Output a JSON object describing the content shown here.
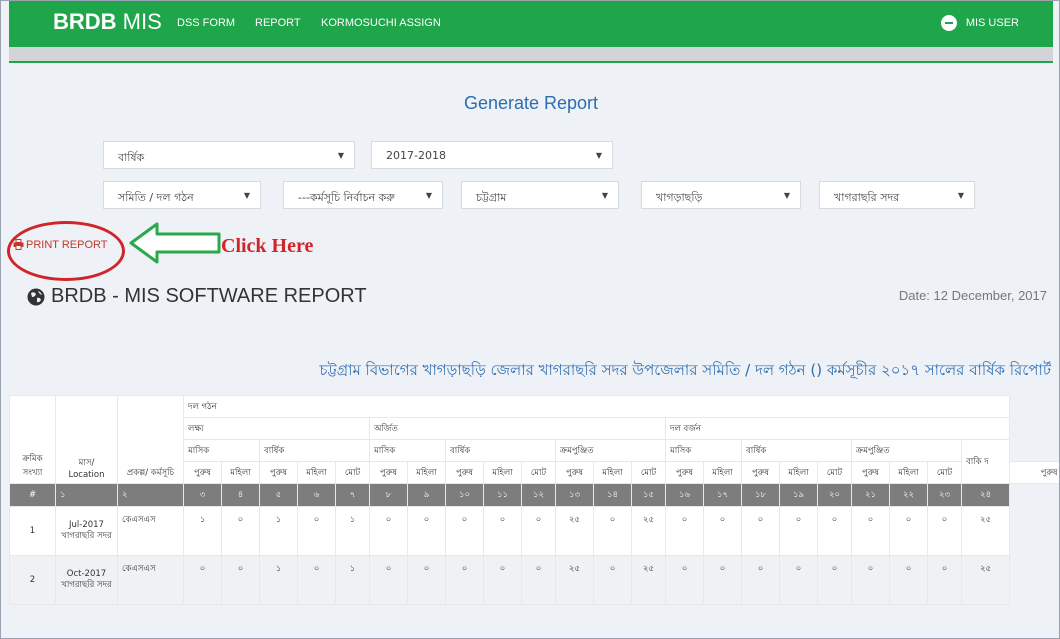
{
  "navbar": {
    "brand_bold": "BRDB",
    "brand_rest": " MIS",
    "links": [
      "DSS FORM",
      "REPORT",
      "KORMOSUCHI ASSIGN"
    ],
    "user": "MIS USER",
    "color": "#1fa64a"
  },
  "page_title": "Generate Report",
  "filters": {
    "row1": [
      "বার্ষিক",
      "2017-2018"
    ],
    "row2": [
      "সমিতি / দল গঠন",
      "---কর্মসূচি নির্বাচন করু",
      "চট্টগ্রাম",
      "খাগড়াছড়ি",
      "খাগরাছরি সদর"
    ]
  },
  "print_button": "PRINT REPORT",
  "annotation": {
    "text": "Click Here",
    "color": "#d0242b"
  },
  "report": {
    "title": "BRDB - MIS SOFTWARE REPORT",
    "date": "Date: 12 December, 2017",
    "headline": "চট্টগ্রাম বিভাগের খাগড়াছড়ি জেলার খাগরাছরি সদর উপজেলার সমিতি / দল গঠন () কর্মসূচীর ২০১৭ সালের বার্ষিক রিপোর্ট"
  },
  "table": {
    "group1": "দল গঠন",
    "target": "লক্ষ্য",
    "achieved": "অর্জিত",
    "dismissed": "দল বর্জন",
    "monthly": "মাসিক",
    "yearly": "বার্ষিক",
    "cumulative": "ক্রমপুঞ্জিত",
    "remaining": "বাকি দ",
    "col_serial": "ক্রমিক সংখ্যা",
    "col_month": "মাস/ Location",
    "col_project": "প্রকল্প/ কর্মসূচি",
    "male": "পুরুষ",
    "female": "মহিলা",
    "total": "মোট",
    "number_row": [
      "#",
      "১",
      "২",
      "৩",
      "৪",
      "৫",
      "৬",
      "৭",
      "৮",
      "৯",
      "১০",
      "১১",
      "১২",
      "১৩",
      "১৪",
      "১৫",
      "১৬",
      "১৭",
      "১৮",
      "১৯",
      "২০",
      "২১",
      "২২",
      "২৩",
      "২৪"
    ],
    "rows": [
      {
        "serial": "1",
        "month": "Jul-2017",
        "location": "খাগরাছরি সদর",
        "project": "কেএসএস",
        "values": [
          "১",
          "০",
          "১",
          "০",
          "১",
          "০",
          "০",
          "০",
          "০",
          "০",
          "২৫",
          "০",
          "২৫",
          "০",
          "০",
          "০",
          "০",
          "০",
          "০",
          "০",
          "০",
          "২৫"
        ]
      },
      {
        "serial": "2",
        "month": "Oct-2017",
        "location": "খাগরাছরি সদর",
        "project": "কেএসএস",
        "values": [
          "০",
          "০",
          "১",
          "০",
          "১",
          "০",
          "০",
          "০",
          "০",
          "০",
          "২৫",
          "০",
          "২৫",
          "০",
          "০",
          "০",
          "০",
          "০",
          "০",
          "০",
          "০",
          "২৫"
        ]
      }
    ]
  }
}
